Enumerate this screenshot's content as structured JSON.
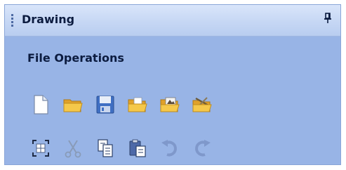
{
  "panel": {
    "title": "Drawing",
    "pin_glyph": "↕"
  },
  "section": {
    "title": "File Operations"
  },
  "toolbar_row1": [
    {
      "icon": "new-document-icon",
      "enabled": true
    },
    {
      "icon": "open-folder-icon",
      "enabled": true
    },
    {
      "icon": "save-floppy-icon",
      "enabled": true
    },
    {
      "icon": "open-folder-pages-icon",
      "enabled": true
    },
    {
      "icon": "folder-export-icon",
      "enabled": true
    },
    {
      "icon": "folder-tools-icon",
      "enabled": true
    }
  ],
  "toolbar_row2": [
    {
      "icon": "select-all-icon",
      "enabled": true
    },
    {
      "icon": "cut-scissors-icon",
      "enabled": false
    },
    {
      "icon": "copy-icon",
      "enabled": true
    },
    {
      "icon": "paste-icon",
      "enabled": true
    },
    {
      "icon": "undo-icon",
      "enabled": false
    },
    {
      "icon": "redo-icon",
      "enabled": false
    }
  ],
  "colors": {
    "panel_bg": "#98b4e6",
    "header_top": "#d9e5fa",
    "header_bottom": "#b9cdf0",
    "text": "#0c1c40"
  }
}
